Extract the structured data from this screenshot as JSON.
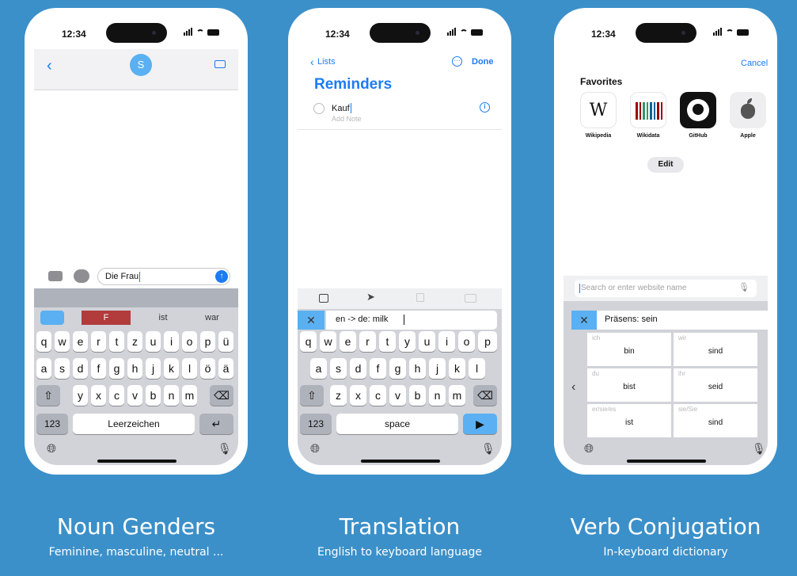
{
  "status": {
    "time": "12:34"
  },
  "panel1": {
    "avatar_letter": "S",
    "message_text": "Die Frau",
    "suggestions": [
      "F",
      "ist",
      "war"
    ],
    "keyboard_rows": [
      [
        "q",
        "w",
        "e",
        "r",
        "t",
        "z",
        "u",
        "i",
        "o",
        "p",
        "ü"
      ],
      [
        "a",
        "s",
        "d",
        "f",
        "g",
        "h",
        "j",
        "k",
        "l",
        "ö",
        "ä"
      ],
      [
        "y",
        "x",
        "c",
        "v",
        "b",
        "n",
        "m"
      ]
    ],
    "num_label": "123",
    "space_label": "Leerzeichen",
    "return_label": "↵",
    "caption_title": "Noun Genders",
    "caption_sub": "Feminine, masculine, neutral ..."
  },
  "panel2": {
    "back_label": "Lists",
    "done_label": "Done",
    "title": "Reminders",
    "item_text": "Kauf",
    "item_note": "Add Note",
    "command_text": "en -> de: milk",
    "keyboard_rows": [
      [
        "q",
        "w",
        "e",
        "r",
        "t",
        "y",
        "u",
        "i",
        "o",
        "p"
      ],
      [
        "a",
        "s",
        "d",
        "f",
        "g",
        "h",
        "j",
        "k",
        "l"
      ],
      [
        "z",
        "x",
        "c",
        "v",
        "b",
        "n",
        "m"
      ]
    ],
    "num_label": "123",
    "space_label": "space",
    "return_label": "▶",
    "caption_title": "Translation",
    "caption_sub": "English to keyboard language"
  },
  "panel3": {
    "cancel_label": "Cancel",
    "favorites_label": "Favorites",
    "favorites": [
      {
        "label": "Wikipedia",
        "glyph": "W"
      },
      {
        "label": "Wikidata",
        "glyph": ""
      },
      {
        "label": "GitHub",
        "glyph": ""
      },
      {
        "label": "Apple",
        "glyph": ""
      }
    ],
    "edit_label": "Edit",
    "search_placeholder": "Search or enter website name",
    "command_text": "Präsens: sein",
    "conjugation": [
      {
        "person": "ich",
        "form": "bin"
      },
      {
        "person": "wir",
        "form": "sind"
      },
      {
        "person": "du",
        "form": "bist"
      },
      {
        "person": "ihr",
        "form": "seid"
      },
      {
        "person": "er/sie/es",
        "form": "ist"
      },
      {
        "person": "sie/Sie",
        "form": "sind"
      }
    ],
    "caption_title": "Verb Conjugation",
    "caption_sub": "In-keyboard dictionary"
  }
}
